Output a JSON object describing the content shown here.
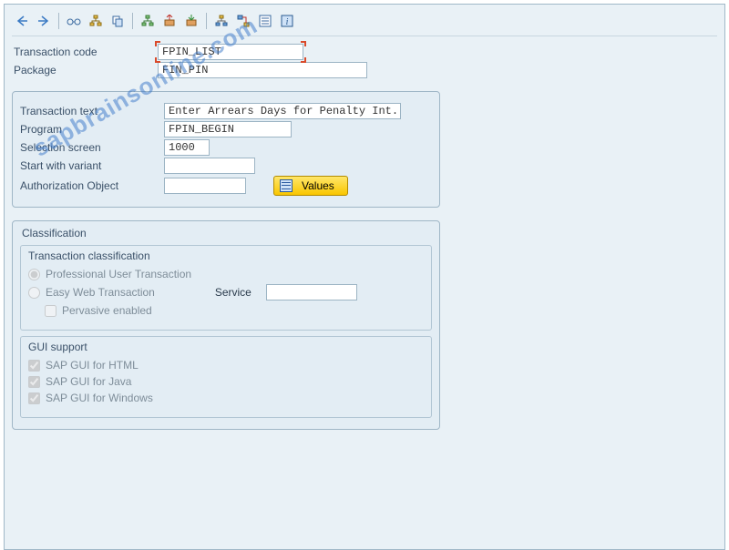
{
  "toolbar": {
    "icons": [
      "back",
      "forward",
      "glasses",
      "tree",
      "copy",
      "network",
      "export",
      "import",
      "hierarchy",
      "assign",
      "checklist",
      "info"
    ]
  },
  "fields": {
    "transaction_code_label": "Transaction code",
    "transaction_code_value": "FPIN_LIST",
    "package_label": "Package",
    "package_value": "FIN_PIN"
  },
  "detail": {
    "transaction_text_label": "Transaction text",
    "transaction_text_value": "Enter Arrears Days for Penalty Int.",
    "program_label": "Program",
    "program_value": "FPIN_BEGIN",
    "selection_screen_label": "Selection screen",
    "selection_screen_value": "1000",
    "start_with_variant_label": "Start with variant",
    "start_with_variant_value": "",
    "authorization_object_label": "Authorization Object",
    "authorization_object_value": "",
    "values_button": "Values"
  },
  "classification": {
    "title": "Classification",
    "trans_class_title": "Transaction classification",
    "radio_professional": "Professional User Transaction",
    "radio_easyweb": "Easy Web Transaction",
    "service_label": "Service",
    "service_value": "",
    "check_pervasive": "Pervasive enabled",
    "gui_support_title": "GUI support",
    "gui_html": "SAP GUI for HTML",
    "gui_java": "SAP GUI for Java",
    "gui_windows": "SAP GUI for Windows"
  },
  "watermark": "sapbrainsonline.com"
}
